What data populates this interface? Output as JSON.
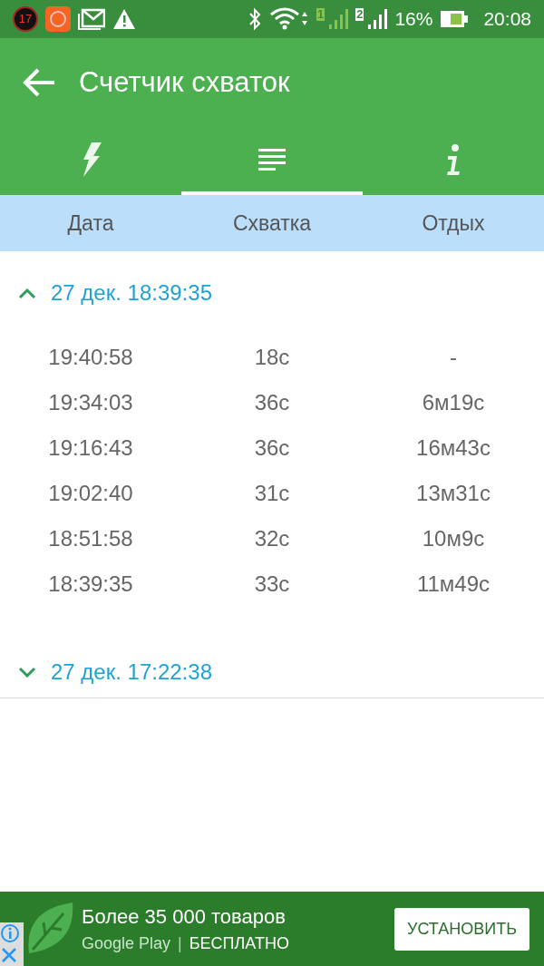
{
  "status_bar": {
    "badge": "17",
    "sim1": "1",
    "sim2": "2",
    "battery": "16%",
    "time": "20:08"
  },
  "toolbar": {
    "title": "Счетчик схваток"
  },
  "tabs": [
    {
      "kind": "bolt",
      "selected": false
    },
    {
      "kind": "list",
      "selected": true
    },
    {
      "kind": "info",
      "selected": false
    }
  ],
  "columns": [
    "Дата",
    "Схватка",
    "Отдых"
  ],
  "groups": [
    {
      "label": "27 дек. 18:39:35",
      "expanded": true,
      "rows": [
        {
          "time": "19:40:58",
          "duration": "18с",
          "rest": "-"
        },
        {
          "time": "19:34:03",
          "duration": "36с",
          "rest": "6м19с"
        },
        {
          "time": "19:16:43",
          "duration": "36с",
          "rest": "16м43с"
        },
        {
          "time": "19:02:40",
          "duration": "31с",
          "rest": "13м31с"
        },
        {
          "time": "18:51:58",
          "duration": "32с",
          "rest": "10м9с"
        },
        {
          "time": "18:39:35",
          "duration": "33с",
          "rest": "11м49с"
        }
      ]
    },
    {
      "label": "27 дек. 17:22:38",
      "expanded": false
    }
  ],
  "ad": {
    "headline": "Более 35 000 товаров",
    "store": "Google Play",
    "separator": "|",
    "price": "БЕСПЛАТНО",
    "button": "УСТАНОВИТЬ"
  }
}
